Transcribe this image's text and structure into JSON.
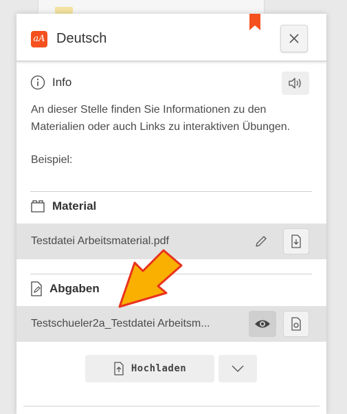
{
  "header": {
    "logo_text": "aA",
    "title": "Deutsch"
  },
  "info": {
    "title": "Info",
    "paragraph1": "An dieser Stelle finden Sie Informationen zu den Materialien oder auch Links zu interaktiven Übungen.",
    "paragraph2": "Beispiel:"
  },
  "material": {
    "title": "Material",
    "file_name": "Testdatei Arbeitsmaterial.pdf"
  },
  "abgaben": {
    "title": "Abgaben",
    "file_name": "Testschueler2a_Testdatei Arbeitsm..."
  },
  "upload": {
    "label": "Hochladen"
  },
  "colors": {
    "accent": "#f4511e",
    "annotation_arrow": "#f9b000",
    "annotation_outline": "#e8321e"
  }
}
